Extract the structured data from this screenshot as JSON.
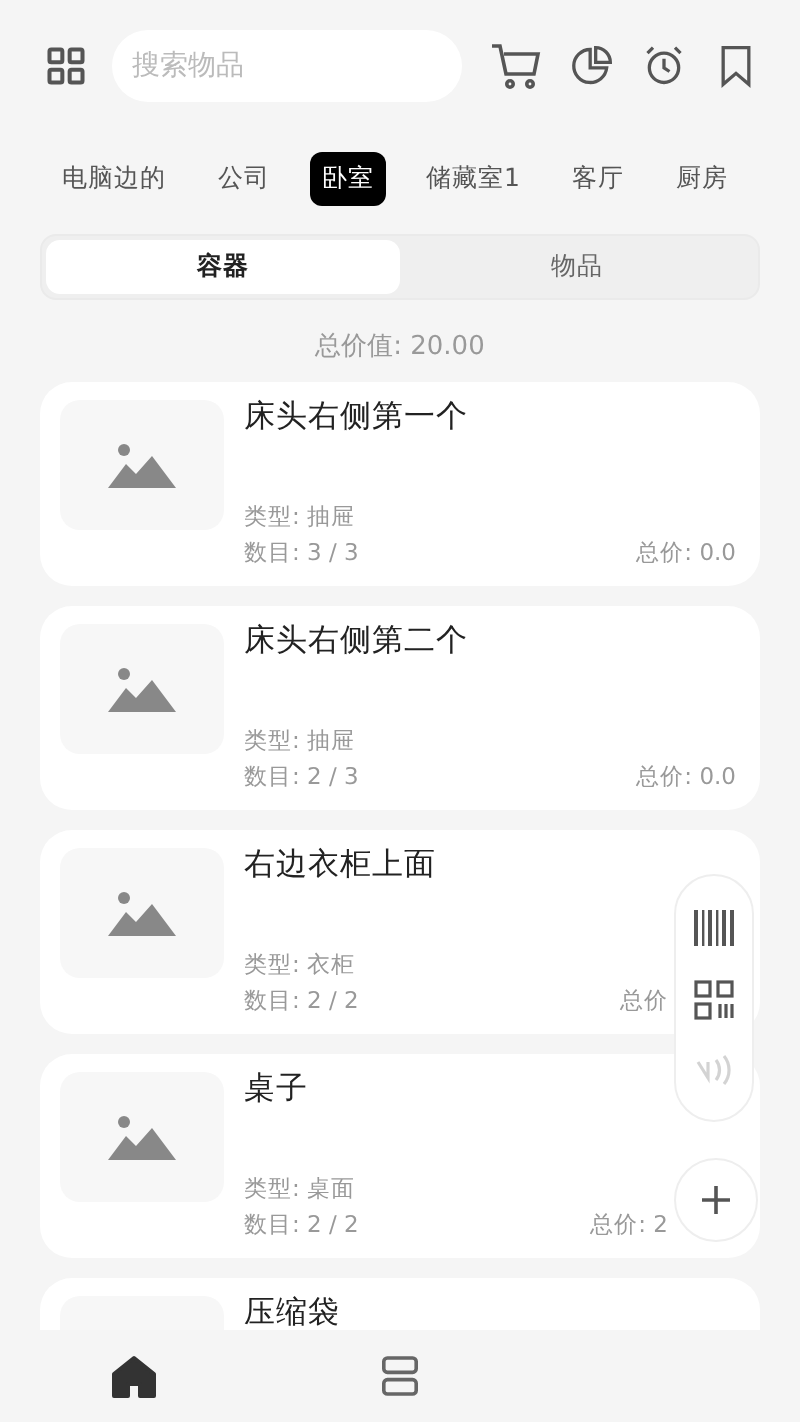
{
  "search": {
    "placeholder": "搜索物品"
  },
  "tabs": [
    {
      "label": "电脑边的",
      "selected": false
    },
    {
      "label": "公司",
      "selected": false
    },
    {
      "label": "卧室",
      "selected": true
    },
    {
      "label": "储藏室1",
      "selected": false
    },
    {
      "label": "客厅",
      "selected": false
    },
    {
      "label": "厨房",
      "selected": false
    }
  ],
  "segments": [
    {
      "label": "容器",
      "selected": true
    },
    {
      "label": "物品",
      "selected": false
    }
  ],
  "total_value": "总价值:  20.00",
  "cards": [
    {
      "title": "床头右侧第一个",
      "type": "类型: 抽屉",
      "count": "数目: 3 / 3",
      "total": "总价: 0.0"
    },
    {
      "title": "床头右侧第二个",
      "type": "类型: 抽屉",
      "count": "数目: 2 / 3",
      "total": "总价: 0.0"
    },
    {
      "title": "右边衣柜上面",
      "type": "类型: 衣柜",
      "count": "数目: 2 / 2",
      "total": "总价"
    },
    {
      "title": "桌子",
      "type": "类型: 桌面",
      "count": "数目: 2 / 2",
      "total": "总价: 2"
    },
    {
      "title": "压缩袋"
    }
  ],
  "scan_tools": [
    {
      "kind": "barcode",
      "disabled": false
    },
    {
      "kind": "qr",
      "disabled": false
    },
    {
      "kind": "nfc",
      "disabled": true
    }
  ],
  "nav": [
    {
      "kind": "home",
      "selected": true
    },
    {
      "kind": "list",
      "selected": false
    }
  ]
}
